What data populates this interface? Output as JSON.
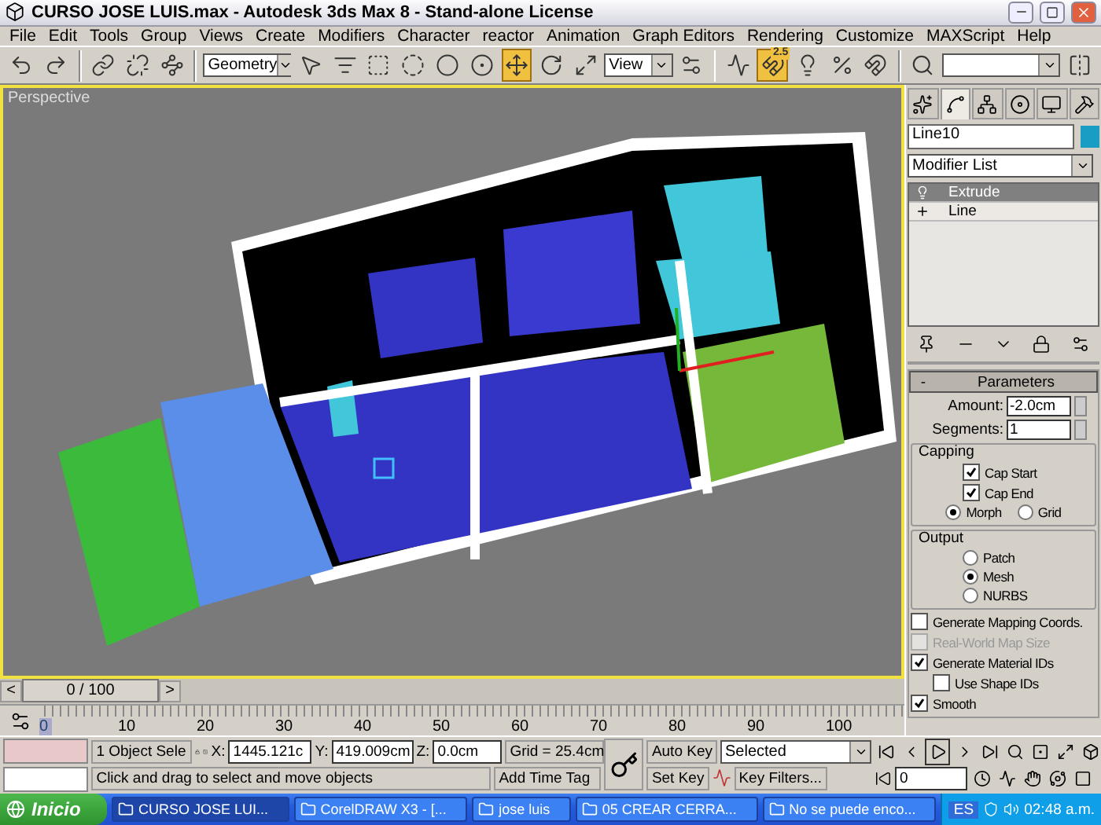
{
  "window": {
    "title": "CURSO JOSE LUIS.max - Autodesk 3ds Max 8  - Stand-alone License"
  },
  "menu": [
    "File",
    "Edit",
    "Tools",
    "Group",
    "Views",
    "Create",
    "Modifiers",
    "Character",
    "reactor",
    "Animation",
    "Graph Editors",
    "Rendering",
    "Customize",
    "MAXScript",
    "Help"
  ],
  "toolbar": {
    "selection_filter": "Geometry",
    "move_tool_selected": true,
    "coordinate_system": "View",
    "snap": {
      "label": "2.5",
      "selected": true
    }
  },
  "viewport": {
    "label": "Perspective",
    "active": true
  },
  "command_panel": {
    "tabs": [
      {
        "selected": false
      },
      {
        "selected": true
      },
      {
        "selected": false
      },
      {
        "selected": false
      },
      {
        "selected": false
      },
      {
        "selected": false
      }
    ],
    "object_name": "Line10",
    "modifier_list": "Modifier List",
    "stack": [
      {
        "label": "Extrude",
        "selected": true
      },
      {
        "label": "Line",
        "selected": false
      }
    ],
    "parameters": {
      "title": "Parameters",
      "collapse": "-",
      "amount": {
        "label": "Amount:",
        "value": "-2.0cm"
      },
      "segments": {
        "label": "Segments:",
        "value": "1"
      },
      "capping": {
        "title": "Capping",
        "checks": [
          {
            "label": "Cap Start",
            "checked": true
          },
          {
            "label": "Cap End",
            "checked": true
          }
        ],
        "options": [
          {
            "label": "Morph",
            "selected": true
          },
          {
            "label": "Grid",
            "selected": false
          }
        ]
      },
      "output": {
        "title": "Output",
        "options": [
          {
            "label": "Patch",
            "selected": false
          },
          {
            "label": "Mesh",
            "selected": true
          },
          {
            "label": "NURBS",
            "selected": false
          }
        ]
      },
      "checks": [
        {
          "label": "Generate Mapping Coords.",
          "checked": false,
          "disabled": false,
          "indented": false
        },
        {
          "label": "Real-World Map Size",
          "checked": false,
          "disabled": true,
          "indented": false
        },
        {
          "label": "Generate Material IDs",
          "checked": true,
          "disabled": false,
          "indented": false
        },
        {
          "label": "Use Shape IDs",
          "checked": false,
          "disabled": false,
          "indented": true
        },
        {
          "label": "Smooth",
          "checked": true,
          "disabled": false,
          "indented": false
        }
      ]
    }
  },
  "time_slider": {
    "label": "0 / 100",
    "level": 0,
    "prev": "<",
    "next": ">"
  },
  "track_bar": {
    "ticks": [
      "0",
      "10",
      "20",
      "30",
      "40",
      "50",
      "60",
      "70",
      "80",
      "90",
      "100"
    ]
  },
  "status": {
    "selection": "1 Object Sele",
    "x": {
      "label": "X:",
      "value": "1445.121c"
    },
    "y": {
      "label": "Y:",
      "value": "419.009cm"
    },
    "z": {
      "label": "Z:",
      "value": "0.0cm"
    },
    "grid": "Grid = 25.4cm",
    "prompt": "Click and drag to select and move objects",
    "add_time_tag": "Add Time Tag",
    "auto_key": {
      "label": "Auto Key",
      "on": false
    },
    "set_key": "Set Key",
    "key_mode": "Selected",
    "key_filters": "Key Filters...",
    "frame": "0"
  },
  "taskbar": {
    "start": "Inicio",
    "tasks": [
      {
        "label": "CURSO JOSE LUI...",
        "selected": true
      },
      {
        "label": "CorelDRAW X3 - [...",
        "selected": false
      },
      {
        "label": "jose luis",
        "selected": false
      },
      {
        "label": "05 CREAR CERRA...",
        "selected": false
      },
      {
        "label": "No se puede enco...",
        "selected": false
      }
    ],
    "language": "ES",
    "clock": "02:48 a.m."
  }
}
